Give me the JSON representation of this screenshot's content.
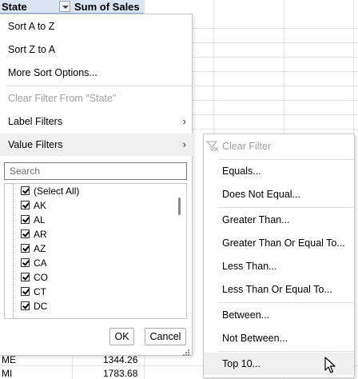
{
  "sheet": {
    "header_state": "State",
    "header_sum": "Sum of Sales",
    "rows": [
      {
        "state": "ME",
        "value": "1344.26"
      },
      {
        "state": "MI",
        "value": "1783.68"
      }
    ]
  },
  "menu": {
    "sort_az": "Sort A to Z",
    "sort_za": "Sort Z to A",
    "more_sort": "More Sort Options...",
    "clear_filter": "Clear Filter From \"State\"",
    "label_filters": "Label Filters",
    "value_filters": "Value Filters",
    "search_placeholder": "Search",
    "items": [
      "(Select All)",
      "AK",
      "AL",
      "AR",
      "AZ",
      "CA",
      "CO",
      "CT",
      "DC"
    ],
    "ok": "OK",
    "cancel": "Cancel"
  },
  "submenu": {
    "clear_filter": "Clear Filter",
    "equals": "Equals...",
    "does_not_equal": "Does Not Equal...",
    "greater_than": "Greater Than...",
    "greater_than_or_equal": "Greater Than Or Equal To...",
    "less_than": "Less Than...",
    "less_than_or_equal": "Less Than Or Equal To...",
    "between": "Between...",
    "not_between": "Not Between...",
    "top10": "Top 10..."
  }
}
